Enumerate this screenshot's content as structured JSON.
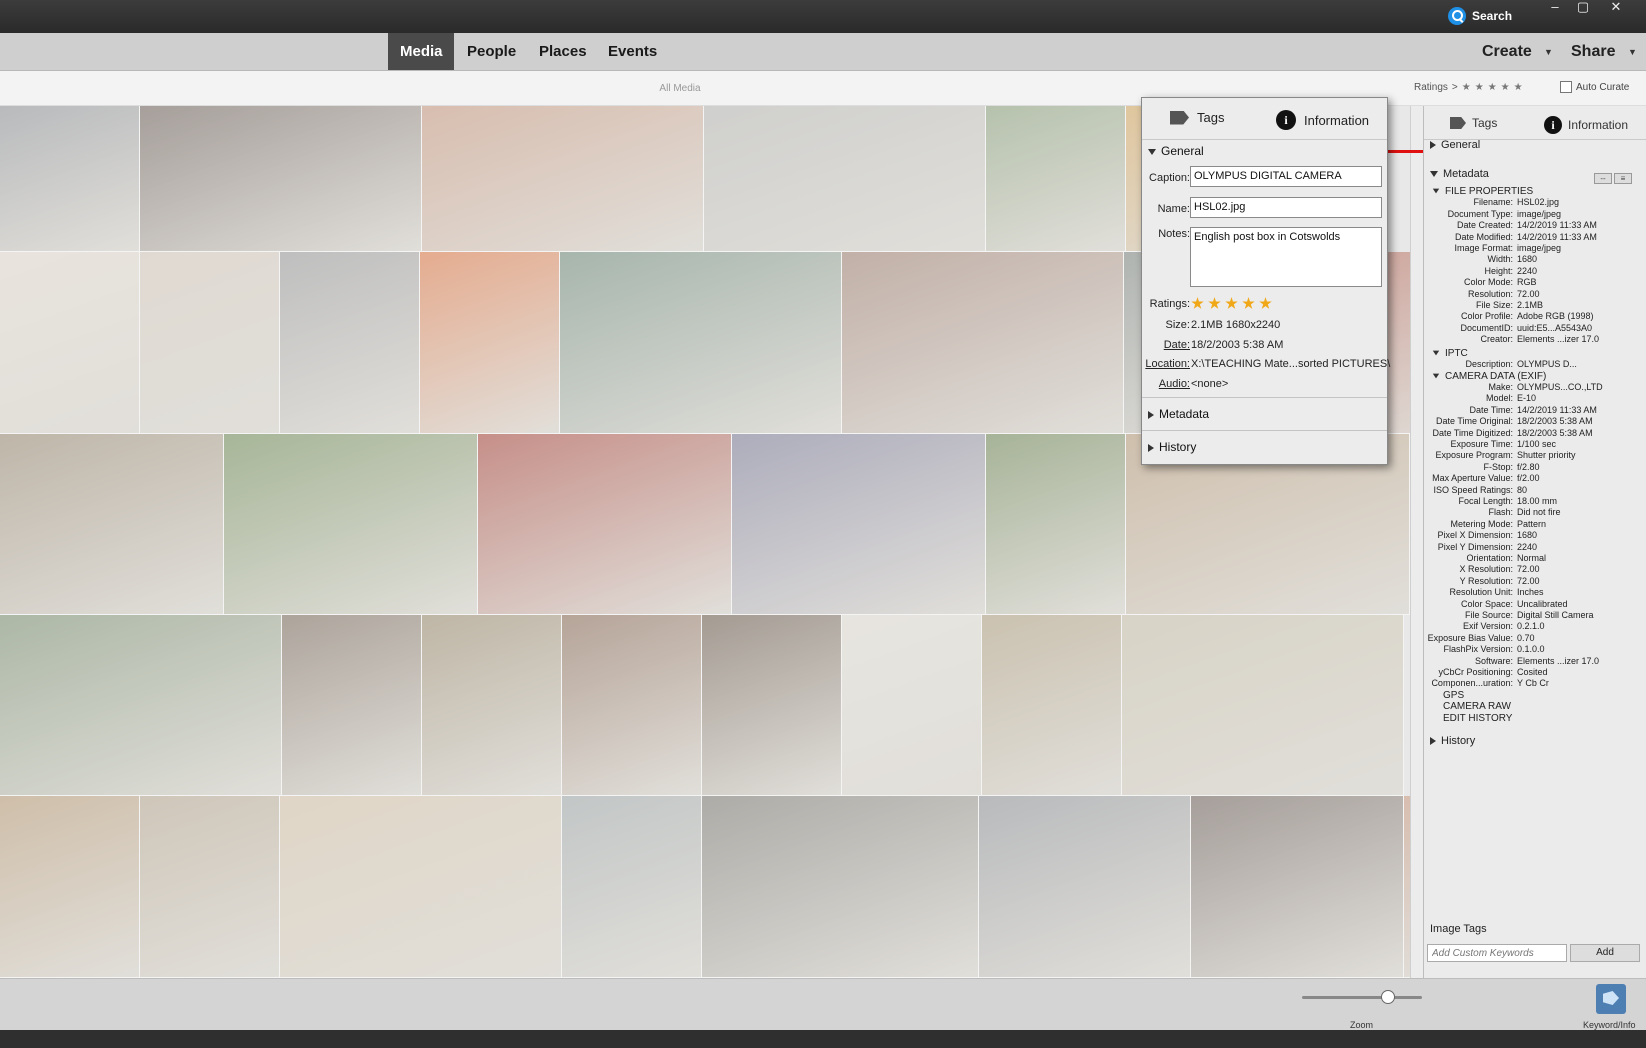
{
  "titlebar": {
    "search_label": "Search",
    "window_controls": [
      "‒",
      "▢",
      "✕"
    ]
  },
  "menubar": {
    "tabs": [
      {
        "label": "Media",
        "active": true
      },
      {
        "label": "People",
        "active": false
      },
      {
        "label": "Places",
        "active": false
      },
      {
        "label": "Events",
        "active": false
      }
    ],
    "create_label": "Create",
    "share_label": "Share"
  },
  "subbar": {
    "title": "All Media",
    "ratings_label": "Ratings",
    "ratings_op": ">",
    "auto_curate_label": "Auto Curate"
  },
  "photo_colors": [
    "#8f9296",
    "#6d6058",
    "#c8987e",
    "#b9b9b5",
    "#8aa07a",
    "#d6a85f",
    "#e6ddd0",
    "#d7cbbd",
    "#9a9a9a",
    "#e07844",
    "#6f8a7a",
    "#a08070",
    "#7e8680",
    "#b26050",
    "#9a8a72",
    "#6f8a54",
    "#a84438",
    "#7a7a96",
    "#6f8654",
    "#b89c7a",
    "#7a8e6e",
    "#7a6a5a",
    "#9a8a6c",
    "#8a6a54",
    "#6a5a4a",
    "#e4e0d6",
    "#b0a080",
    "#c8c0a8",
    "#b89a74",
    "#b8a890",
    "#d8c4a8",
    "#a0a8a8",
    "#7a7870"
  ],
  "popup": {
    "tabs": {
      "tags": "Tags",
      "information": "Information"
    },
    "general_label": "General",
    "caption_label": "Caption:",
    "caption_value": "OLYMPUS DIGITAL CAMERA",
    "name_label": "Name:",
    "name_value": "HSL02.jpg",
    "notes_label": "Notes:",
    "notes_value": "English post box in Cotswolds",
    "ratings_label": "Ratings:",
    "rating": 5,
    "size_label": "Size:",
    "size_value": "2.1MB  1680x2240",
    "date_label": "Date:",
    "date_value": "18/2/2003 5:38 AM",
    "location_label": "Location:",
    "location_value": "X:\\TEACHING Mate...sorted PICTURES\\",
    "audio_label": "Audio:",
    "audio_value": "<none>",
    "metadata_label": "Metadata",
    "history_label": "History"
  },
  "panel": {
    "tabs": {
      "tags": "Tags",
      "information": "Information"
    },
    "general_label": "General",
    "metadata_label": "Metadata",
    "file_properties_label": "FILE PROPERTIES",
    "file_properties": [
      [
        "Filename:",
        "HSL02.jpg"
      ],
      [
        "Document Type:",
        "image/jpeg"
      ],
      [
        "Date Created:",
        "14/2/2019 11:33 AM"
      ],
      [
        "Date Modified:",
        "14/2/2019 11:33 AM"
      ],
      [
        "Image Format:",
        "image/jpeg"
      ],
      [
        "Width:",
        "1680"
      ],
      [
        "Height:",
        "2240"
      ],
      [
        "Color Mode:",
        "RGB"
      ],
      [
        "Resolution:",
        "72.00"
      ],
      [
        "File Size:",
        "2.1MB"
      ],
      [
        "Color Profile:",
        "Adobe RGB (1998)"
      ],
      [
        "DocumentID:",
        "uuid:E5...A5543A0"
      ],
      [
        "Creator:",
        "Elements ...izer 17.0"
      ]
    ],
    "iptc_label": "IPTC",
    "iptc": [
      [
        "Description:",
        "OLYMPUS D..."
      ]
    ],
    "camera_label": "CAMERA DATA (EXIF)",
    "camera": [
      [
        "Make:",
        "OLYMPUS...CO.,LTD"
      ],
      [
        "Model:",
        "E-10"
      ],
      [
        "Date Time:",
        "14/2/2019 11:33 AM"
      ],
      [
        "Date Time Original:",
        "18/2/2003 5:38 AM"
      ],
      [
        "Date Time Digitized:",
        "18/2/2003 5:38 AM"
      ],
      [
        "Exposure Time:",
        "1/100 sec"
      ],
      [
        "Exposure Program:",
        "Shutter priority"
      ],
      [
        "F-Stop:",
        "f/2.80"
      ],
      [
        "Max Aperture Value:",
        "f/2.00"
      ],
      [
        "ISO Speed Ratings:",
        "80"
      ],
      [
        "Focal Length:",
        "18.00 mm"
      ],
      [
        "Flash:",
        "Did not fire"
      ],
      [
        "Metering Mode:",
        "Pattern"
      ],
      [
        "Pixel X Dimension:",
        "1680"
      ],
      [
        "Pixel Y Dimension:",
        "2240"
      ],
      [
        "Orientation:",
        "Normal"
      ],
      [
        "X Resolution:",
        "72.00"
      ],
      [
        "Y Resolution:",
        "72.00"
      ],
      [
        "Resolution Unit:",
        "Inches"
      ],
      [
        "Color Space:",
        "Uncalibrated"
      ],
      [
        "File Source:",
        "Digital Still Camera"
      ],
      [
        "Exif Version:",
        "0.2.1.0"
      ],
      [
        "Exposure Bias Value:",
        "0.70"
      ],
      [
        "FlashPix Version:",
        "0.1.0.0"
      ],
      [
        "Software:",
        "Elements ...izer 17.0"
      ],
      [
        "yCbCr Positioning:",
        "Cosited"
      ],
      [
        "Componen...uration:",
        "Y Cb Cr"
      ]
    ],
    "extra_sections": [
      "GPS",
      "CAMERA RAW",
      "EDIT HISTORY"
    ],
    "history_label": "History",
    "image_tags_label": "Image Tags",
    "keyword_placeholder": "Add Custom Keywords",
    "add_label": "Add"
  },
  "bottombar": {
    "zoom_label": "Zoom",
    "zoom_fraction": 0.72,
    "keyword_info_label": "Keyword/Info"
  }
}
